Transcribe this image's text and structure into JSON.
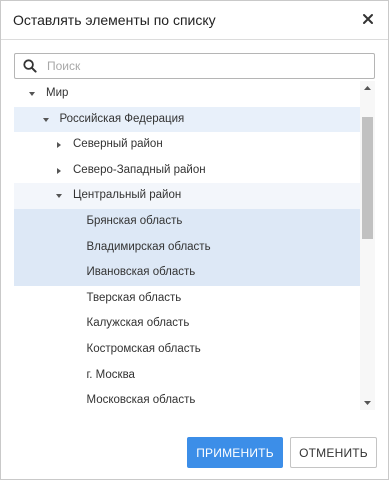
{
  "dialog": {
    "title": "Оставлять элементы по списку",
    "close_icon": "close-icon"
  },
  "search": {
    "placeholder": "Поиск",
    "value": "",
    "icon": "search-icon"
  },
  "tree": {
    "items": [
      {
        "label": "Мир",
        "level": 0,
        "toggle": "expanded",
        "state": "normal"
      },
      {
        "label": "Российская Федерация",
        "level": 1,
        "toggle": "expanded",
        "state": "highlight"
      },
      {
        "label": "Северный район",
        "level": 2,
        "toggle": "collapsed",
        "state": "normal"
      },
      {
        "label": "Северо-Западный район",
        "level": 2,
        "toggle": "collapsed",
        "state": "normal"
      },
      {
        "label": "Центральный район",
        "level": 2,
        "toggle": "expanded",
        "state": "hover"
      },
      {
        "label": "Брянская область",
        "level": 3,
        "toggle": "none",
        "state": "selected"
      },
      {
        "label": "Владимирская область",
        "level": 3,
        "toggle": "none",
        "state": "selected"
      },
      {
        "label": "Ивановская область",
        "level": 3,
        "toggle": "none",
        "state": "selected"
      },
      {
        "label": "Тверская область",
        "level": 3,
        "toggle": "none",
        "state": "normal"
      },
      {
        "label": "Калужская область",
        "level": 3,
        "toggle": "none",
        "state": "normal"
      },
      {
        "label": "Костромская область",
        "level": 3,
        "toggle": "none",
        "state": "normal"
      },
      {
        "label": "г. Москва",
        "level": 3,
        "toggle": "none",
        "state": "normal"
      },
      {
        "label": "Московская область",
        "level": 3,
        "toggle": "none",
        "state": "normal"
      }
    ]
  },
  "buttons": {
    "apply": "ПРИМЕНИТЬ",
    "cancel": "ОТМЕНИТЬ"
  },
  "colors": {
    "accent": "#3c8ee8",
    "selected_row": "#dde8f6",
    "hover_row": "#f3f6fb"
  }
}
